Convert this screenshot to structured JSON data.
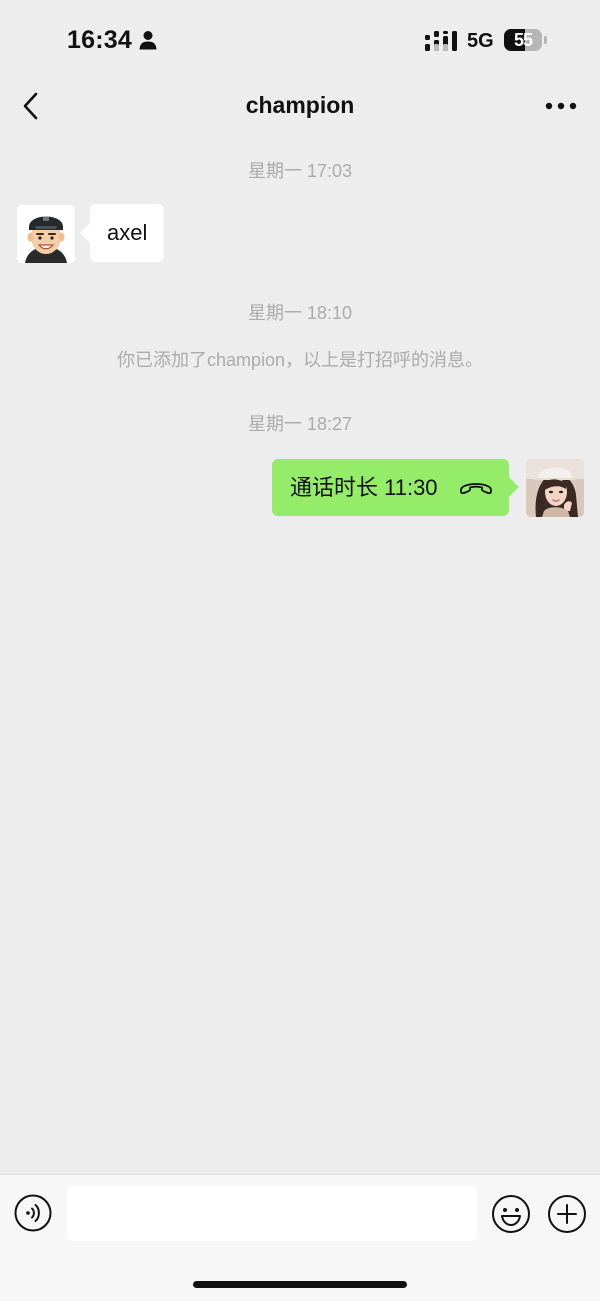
{
  "status_bar": {
    "time": "16:34",
    "network": "5G",
    "battery": "55",
    "battery_level_percent": 55,
    "icons": [
      "person-icon",
      "signal-icon"
    ]
  },
  "nav": {
    "title": "champion",
    "icons": [
      "back-chevron-icon",
      "more-dots-icon"
    ]
  },
  "messages": [
    {
      "type": "timestamp",
      "text": "星期一 17:03"
    },
    {
      "type": "incoming",
      "text": "axel",
      "avatar": "cartoon-man-cap-avatar"
    },
    {
      "type": "timestamp",
      "text": "星期一 18:10"
    },
    {
      "type": "system",
      "text": "你已添加了champion，以上是打招呼的消息。"
    },
    {
      "type": "timestamp",
      "text": "星期一 18:27"
    },
    {
      "type": "outgoing",
      "text": "通话时长 11:30",
      "icon": "phone-hangup-icon",
      "avatar": "woman-photo-avatar"
    }
  ],
  "input_bar": {
    "placeholder": "",
    "icons": [
      "voice-icon",
      "emoji-icon",
      "plus-icon"
    ]
  },
  "colors": {
    "background": "#ededed",
    "outgoing_bubble": "#95ec69",
    "incoming_bubble": "#ffffff",
    "timestamp_text": "#ababab"
  }
}
